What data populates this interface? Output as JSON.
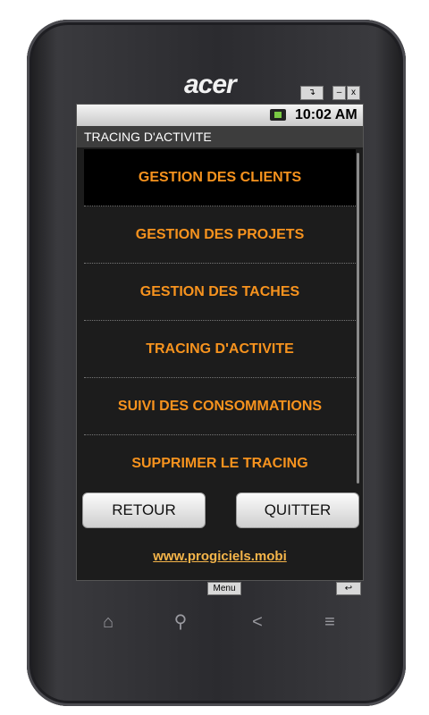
{
  "device": {
    "brand": "acer",
    "emulator_buttons": {
      "rotate": "↴",
      "minimize": "–",
      "close": "x"
    },
    "menu_key_label": "Menu",
    "back_key_label": "↩"
  },
  "status_bar": {
    "time": "10:02 AM",
    "battery_icon": "battery-charging-icon"
  },
  "app": {
    "title": "TRACING D'ACTIVITE",
    "menu_items": [
      {
        "label": "GESTION DES CLIENTS"
      },
      {
        "label": "GESTION DES PROJETS"
      },
      {
        "label": "GESTION DES TACHES"
      },
      {
        "label": "TRACING D'ACTIVITE"
      },
      {
        "label": "SUIVI DES CONSOMMATIONS"
      },
      {
        "label": "SUPPRIMER LE TRACING"
      }
    ],
    "buttons": {
      "back": "RETOUR",
      "quit": "QUITTER"
    },
    "website": "www.progiciels.mobi",
    "accent_color": "#f7931e"
  },
  "nav_keys": {
    "home": "⌂",
    "search": "⚲",
    "back": "<",
    "menu": "≡"
  }
}
